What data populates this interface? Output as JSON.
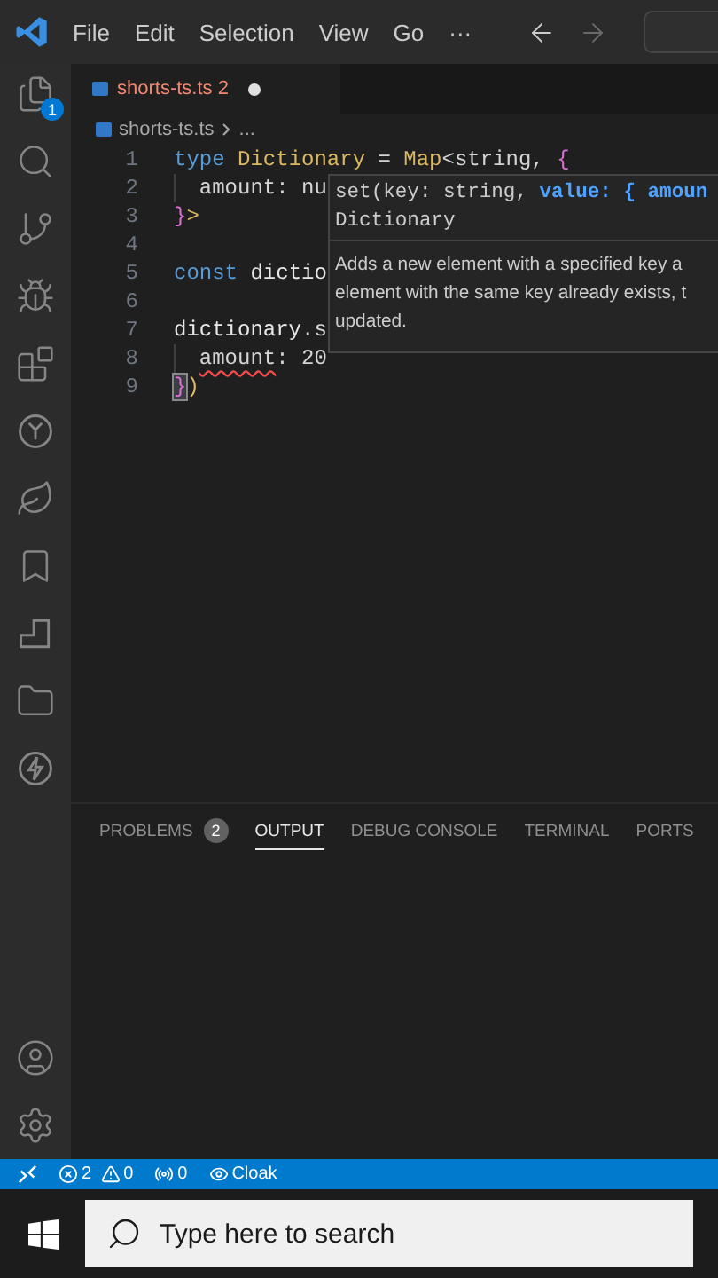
{
  "menu": [
    {
      "label": "File"
    },
    {
      "label": "Edit"
    },
    {
      "label": "Selection"
    },
    {
      "label": "View"
    },
    {
      "label": "Go"
    },
    {
      "label": "···"
    }
  ],
  "nav": [
    {
      "kind": "back",
      "disabled": false
    },
    {
      "kind": "forward",
      "disabled": true
    }
  ],
  "activity_bar": {
    "explorer_badge": "1"
  },
  "tab": {
    "label": "shorts-ts.ts",
    "problems": "2",
    "dirty": true
  },
  "breadcrumb": [
    {
      "label": "shorts-ts.ts"
    },
    {
      "label": "..."
    }
  ],
  "code": [
    {
      "number": "1",
      "indented": false,
      "tokens": [
        {
          "text": "type ",
          "kind": "keyword",
          "error": false
        },
        {
          "text": "Dictionary",
          "kind": "type",
          "error": false
        },
        {
          "text": " = ",
          "kind": "plain",
          "error": false
        },
        {
          "text": "Map",
          "kind": "type",
          "error": false
        },
        {
          "text": "<string, ",
          "kind": "plain",
          "error": false
        },
        {
          "text": "{",
          "kind": "bracket",
          "error": false
        }
      ]
    },
    {
      "number": "2",
      "indented": true,
      "tokens": [
        {
          "text": "amount",
          "kind": "property",
          "error": false
        },
        {
          "text": ": nu",
          "kind": "plain",
          "error": false
        }
      ]
    },
    {
      "number": "3",
      "indented": false,
      "tokens": [
        {
          "text": "}",
          "kind": "bracket",
          "error": false
        },
        {
          "text": ">",
          "kind": "type",
          "error": false
        }
      ]
    },
    {
      "number": "4",
      "indented": false
    },
    {
      "number": "5",
      "indented": false,
      "tokens": [
        {
          "text": "const ",
          "kind": "keyword",
          "error": false
        },
        {
          "text": "dictio",
          "kind": "variable",
          "error": false
        }
      ]
    },
    {
      "number": "6",
      "indented": false
    },
    {
      "number": "7",
      "indented": false,
      "tokens": [
        {
          "text": "dictionary",
          "kind": "variable",
          "error": false
        },
        {
          "text": ".s",
          "kind": "plain",
          "error": false
        }
      ]
    },
    {
      "number": "8",
      "indented": true,
      "tokens": [
        {
          "text": "amount",
          "kind": "property",
          "error": true
        },
        {
          "text": ": 20",
          "kind": "plain",
          "error": false
        }
      ]
    },
    {
      "number": "9",
      "indented": false,
      "tokens": [
        {
          "text": "}",
          "kind": "matched",
          "error": false
        },
        {
          "text": ")",
          "kind": "type",
          "error": false
        }
      ]
    }
  ],
  "hover": {
    "signature_start": "set(key: string, ",
    "signature_param": "value: { amoun",
    "type_name": "Dictionary",
    "description_lines": [
      "Adds a new element with a specified key a",
      "element with the same key already exists, t",
      "updated."
    ]
  },
  "panel_tabs": [
    {
      "label": "PROBLEMS",
      "count": "2",
      "selected": false
    },
    {
      "label": "OUTPUT",
      "selected": true
    },
    {
      "label": "DEBUG CONSOLE",
      "selected": false
    },
    {
      "label": "TERMINAL",
      "selected": false
    },
    {
      "label": "PORTS",
      "selected": false
    }
  ],
  "status_bar": {
    "errors": "2",
    "warnings": "0",
    "ports": "0",
    "cloak": "Cloak"
  },
  "taskbar": {
    "search_placeholder": "Type here to search"
  }
}
